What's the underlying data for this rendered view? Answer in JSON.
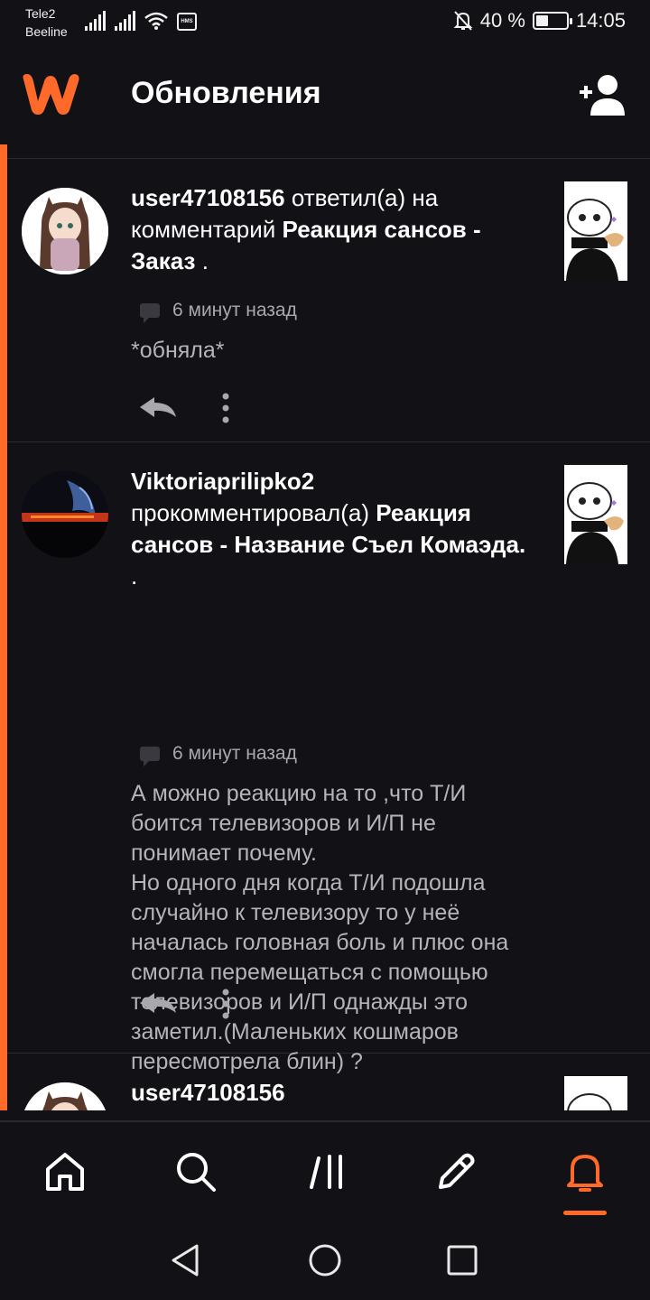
{
  "status_bar": {
    "carrier_1": "Tele2",
    "carrier_2": "Beeline",
    "hms_label": "HMS",
    "battery_text": "40 %",
    "battery_level": 0.4,
    "time": "14:05"
  },
  "header": {
    "title": "Обновления"
  },
  "colors": {
    "accent": "#ff6a2b",
    "background": "#121115",
    "muted_text": "#a9a8ad"
  },
  "feed": {
    "items": [
      {
        "user": "user47108156",
        "action": " ответил(а) на комментарий ",
        "story": "Реакция сансов - Заказ",
        "tail": " .",
        "time": "6 минут назад",
        "body": "*обняла*"
      },
      {
        "user": "Viktoriaprilipko2",
        "action": " прокомментировал(а) ",
        "story": "Реакция сансов - Название Съел Комаэда.",
        "tail": " .",
        "time": "6 минут назад",
        "body": "А можно реакцию на то ,что Т/И  боится телевизоров и И/П не понимает почему.\nНо одного дня когда Т/И подошла случайно к телевизору то у неё началась головная боль и плюс она смогла перемещаться с помощью телевизоров и И/П однажды это заметил.(Маленьких кошмаров пересмотрела блин) ?"
      },
      {
        "user": "user47108156"
      }
    ]
  },
  "bottom_nav": {
    "items": [
      "home-icon",
      "search-icon",
      "library-icon",
      "write-icon",
      "notifications-icon"
    ],
    "active": "notifications-icon"
  }
}
